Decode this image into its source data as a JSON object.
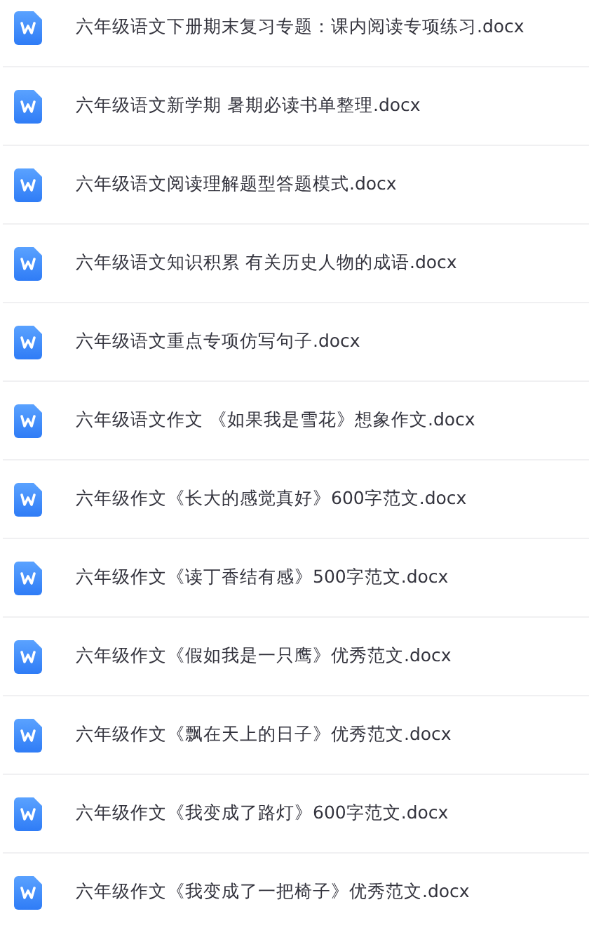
{
  "files": [
    {
      "name": "六年级语文下册期末复习专题：课内阅读专项练习.docx"
    },
    {
      "name": "六年级语文新学期 暑期必读书单整理.docx"
    },
    {
      "name": "六年级语文阅读理解题型答题模式.docx"
    },
    {
      "name": "六年级语文知识积累 有关历史人物的成语.docx"
    },
    {
      "name": "六年级语文重点专项仿写句子.docx"
    },
    {
      "name": "六年级语文作文 《如果我是雪花》想象作文.docx"
    },
    {
      "name": "六年级作文《长大的感觉真好》600字范文.docx"
    },
    {
      "name": "六年级作文《读丁香结有感》500字范文.docx"
    },
    {
      "name": "六年级作文《假如我是一只鹰》优秀范文.docx"
    },
    {
      "name": "六年级作文《飘在天上的日子》优秀范文.docx"
    },
    {
      "name": "六年级作文《我变成了路灯》600字范文.docx"
    },
    {
      "name": "六年级作文《我变成了一把椅子》优秀范文.docx"
    }
  ]
}
